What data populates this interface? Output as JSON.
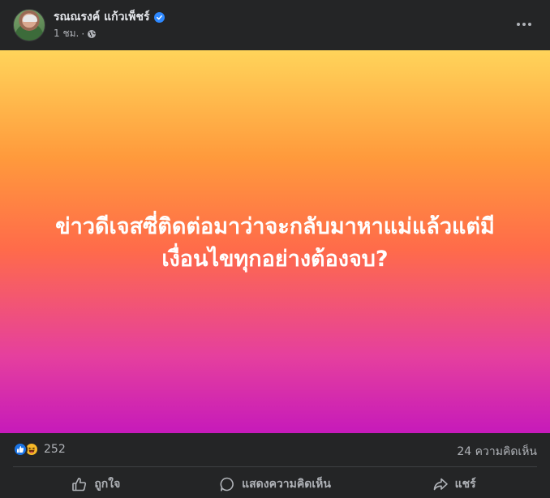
{
  "post": {
    "author_name": "รณณรงค์ แก้วเพ็ชร์",
    "timestamp": "1 ชม.",
    "separator": "·",
    "privacy_icon": "globe-icon",
    "verified_icon": "verified-badge-icon",
    "background_gradient": [
      "#ffd45a",
      "#ff9a3c",
      "#ff6b4a",
      "#e53f9e",
      "#c61aba"
    ],
    "text_line1": "ข่าวดีเจสซี่ติดต่อมาว่าจะกลับมาหาแม่แล้วแต่มี",
    "text_line2": "เงื่อนไขทุกอย่างต้องจบ?"
  },
  "stats": {
    "reaction_icons": [
      "like-icon",
      "haha-icon"
    ],
    "reactions_count": "252",
    "comments_label": "24 ความคิดเห็น"
  },
  "actions": {
    "like_label": "ถูกใจ",
    "comment_label": "แสดงความคิดเห็น",
    "share_label": "แชร์"
  },
  "colors": {
    "background": "#242526",
    "secondary_text": "#b0b3b8",
    "primary_text": "#e4e6eb",
    "verified_blue": "#2d88ff",
    "like_blue": "#1b74e4",
    "haha_yellow": "#f7b928"
  }
}
